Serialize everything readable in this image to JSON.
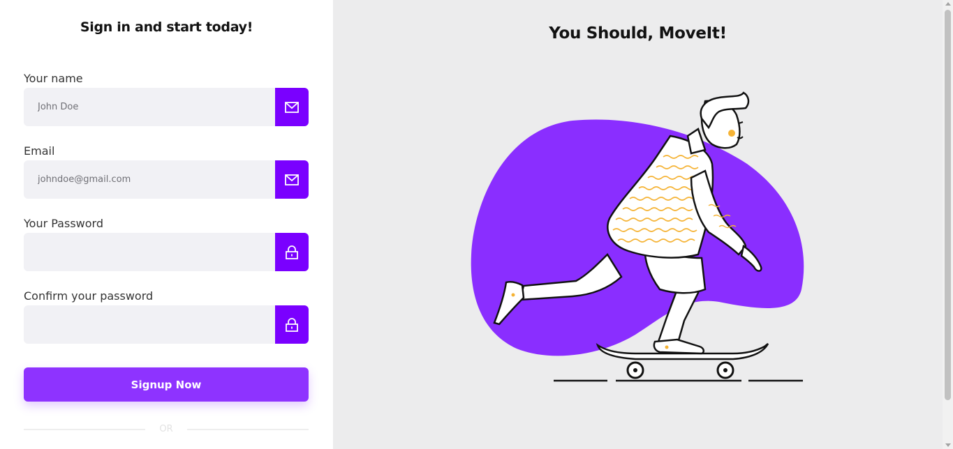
{
  "form": {
    "title": "Sign in and start today!",
    "fields": [
      {
        "label": "Your name",
        "placeholder": "John Doe",
        "icon": "mail-icon"
      },
      {
        "label": "Email",
        "placeholder": "johndoe@gmail.com",
        "icon": "mail-icon"
      },
      {
        "label": "Your Password",
        "placeholder": "",
        "icon": "lock-icon"
      },
      {
        "label": "Confirm your password",
        "placeholder": "",
        "icon": "lock-icon"
      }
    ],
    "submit_label": "Signup Now",
    "divider_text": "OR"
  },
  "hero": {
    "title": "You Should, MoveIt!"
  },
  "colors": {
    "accent": "#7a00ff",
    "button": "#8e33ff",
    "blob": "#8a2eff",
    "panel_bg": "#ececed",
    "input_bg": "#f1f1f5",
    "sweater_stripes": "#f5b335"
  }
}
